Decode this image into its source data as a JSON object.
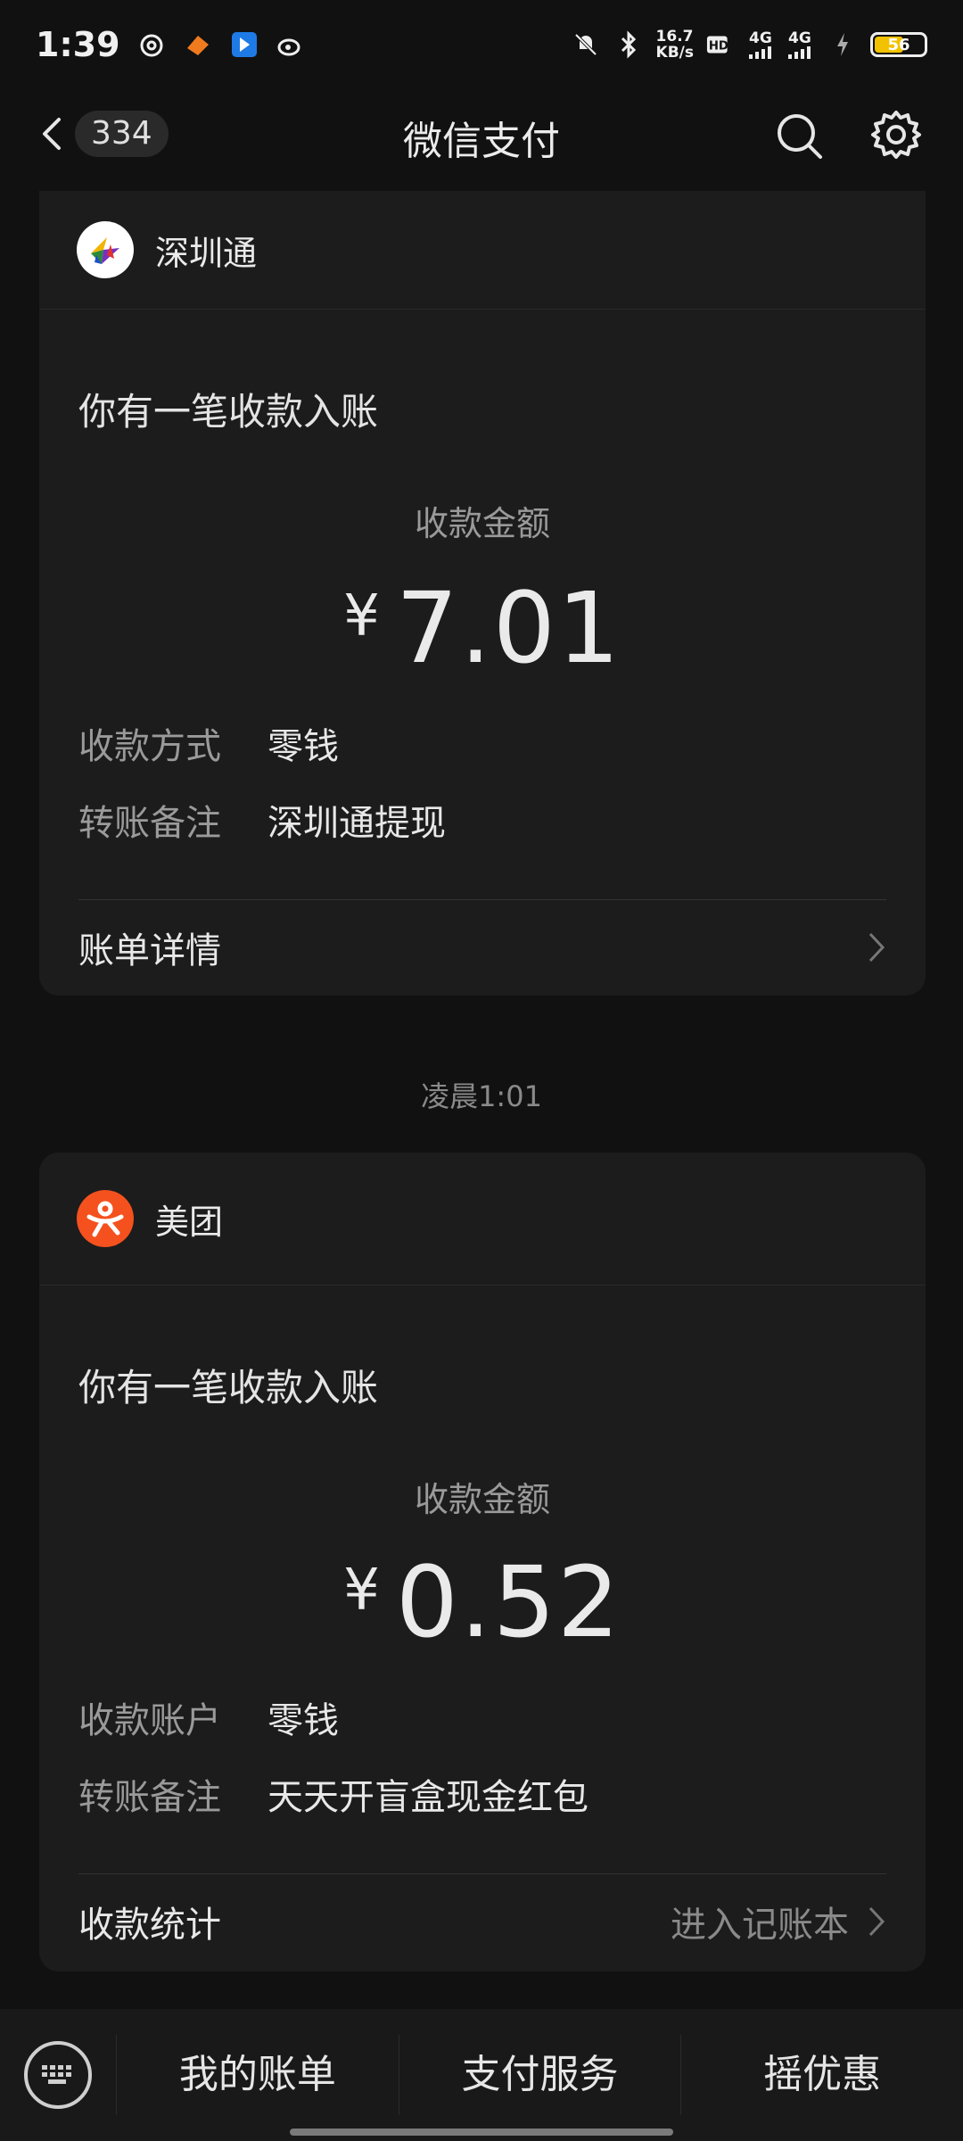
{
  "status": {
    "time": "1:39",
    "net_speed_top": "16.7",
    "net_speed_bottom": "KB/s",
    "sig1": "4G",
    "sig2": "4G",
    "battery": "56"
  },
  "nav": {
    "badge": "334",
    "title": "微信支付"
  },
  "cards": [
    {
      "merchant": "深圳通",
      "title": "你有一笔收款入账",
      "amount_label": "收款金额",
      "currency": "¥",
      "amount": "7.01",
      "rows": [
        {
          "k": "收款方式",
          "v": "零钱"
        },
        {
          "k": "转账备注",
          "v": "深圳通提现"
        }
      ],
      "footer_left": "账单详情",
      "footer_right": ""
    },
    {
      "merchant": "美团",
      "title": "你有一笔收款入账",
      "amount_label": "收款金额",
      "currency": "¥",
      "amount": "0.52",
      "rows": [
        {
          "k": "收款账户",
          "v": "零钱"
        },
        {
          "k": "转账备注",
          "v": "天天开盲盒现金红包"
        }
      ],
      "footer_left": "收款统计",
      "footer_right": "进入记账本"
    }
  ],
  "timestamp": "凌晨1:01",
  "bottom_tabs": [
    "我的账单",
    "支付服务",
    "摇优惠"
  ],
  "colors": {
    "meituan": "#f4511e",
    "bg": "#111111",
    "card": "#1c1c1c"
  }
}
